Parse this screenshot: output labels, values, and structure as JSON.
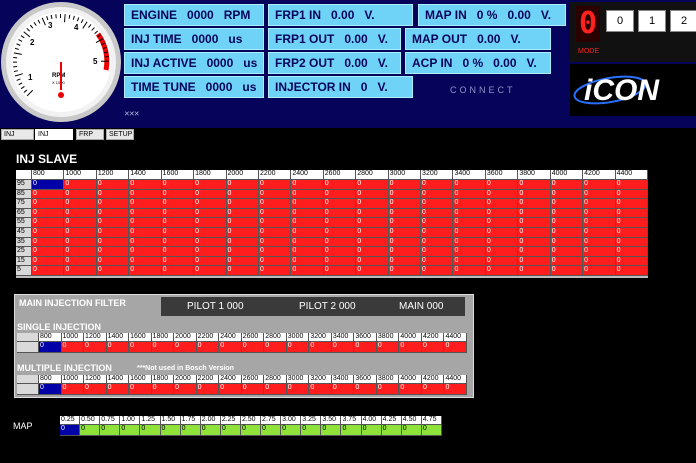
{
  "gauge": {
    "ticks": [
      "1",
      "2",
      "3",
      "4",
      "5"
    ],
    "label_top": "RPM",
    "label_bottom": "X 1000"
  },
  "lcd": {
    "engine": {
      "label": "ENGINE",
      "value": "0000",
      "unit": "RPM"
    },
    "inj_time": {
      "label": "INJ TIME",
      "value": "0000",
      "unit": "us"
    },
    "inj_active": {
      "label": "INJ ACTIVE",
      "value": "0000",
      "unit": "us"
    },
    "time_tune": {
      "label": "TIME TUNE",
      "value": "0000",
      "unit": "us"
    },
    "frp1_in": {
      "label": "FRP1 IN",
      "value": "0.00",
      "unit": "V."
    },
    "frp1_out": {
      "label": "FRP1 OUT",
      "value": "0.00",
      "unit": "V."
    },
    "frp2_out": {
      "label": "FRP2 OUT",
      "value": "0.00",
      "unit": "V."
    },
    "injector_in": {
      "label": "INJECTOR IN",
      "value": "0",
      "unit": "V."
    },
    "map_in": {
      "label": "MAP IN",
      "pct": "0 %",
      "value": "0.00",
      "unit": "V."
    },
    "map_out": {
      "label": "MAP OUT",
      "value": "0.00",
      "unit": "V."
    },
    "acp_in": {
      "label": "ACP IN",
      "pct": "0 %",
      "value": "0.00",
      "unit": "V."
    }
  },
  "connect_label": "CONNECT",
  "mode": {
    "digit": "0",
    "label": "MODE",
    "buttons": [
      "0",
      "1",
      "2"
    ]
  },
  "logo_text": "iCON",
  "tabs": [
    "INJ MAIN",
    "INJ SLAVE",
    "FRP",
    "SETUP"
  ],
  "slave": {
    "title": "INJ SLAVE",
    "columns": [
      "800",
      "1000",
      "1200",
      "1400",
      "1600",
      "1800",
      "2000",
      "2200",
      "2400",
      "2600",
      "2800",
      "3000",
      "3200",
      "3400",
      "3600",
      "3800",
      "4000",
      "4200",
      "4400"
    ],
    "rows": [
      "95",
      "85",
      "75",
      "65",
      "55",
      "45",
      "35",
      "25",
      "15",
      "5"
    ],
    "cell_value": "0"
  },
  "filter": {
    "title": "MAIN INJECTION FILTER",
    "pilot1": "PILOT 1  000",
    "pilot2": "PILOT 2  000",
    "main": "MAIN   000",
    "single_label": "SINGLE INJECTION",
    "multiple_label": "MULTIPLE INJECTION",
    "bosch_note": "***Not used in Bosch Version",
    "columns": [
      "800",
      "1000",
      "1200",
      "1400",
      "1600",
      "1800",
      "2000",
      "2200",
      "2400",
      "2600",
      "2800",
      "3000",
      "3200",
      "3400",
      "3600",
      "3800",
      "4000",
      "4200",
      "4400"
    ],
    "cell_value": "0"
  },
  "map": {
    "label": "MAP",
    "columns": [
      "0.25",
      "0.50",
      "0.75",
      "1.00",
      "1.25",
      "1.50",
      "1.75",
      "2.00",
      "2.25",
      "2.50",
      "2.75",
      "3.00",
      "3.25",
      "3.50",
      "3.75",
      "4.00",
      "4.25",
      "4.50",
      "4.75"
    ],
    "cell_value": "0"
  },
  "colors": {
    "header_bg": "#05045a",
    "lcd": "#6fd3f7",
    "cell_red": "#ff1d1d",
    "cell_selected": "#0000a8",
    "cell_green": "#8ee23a"
  }
}
